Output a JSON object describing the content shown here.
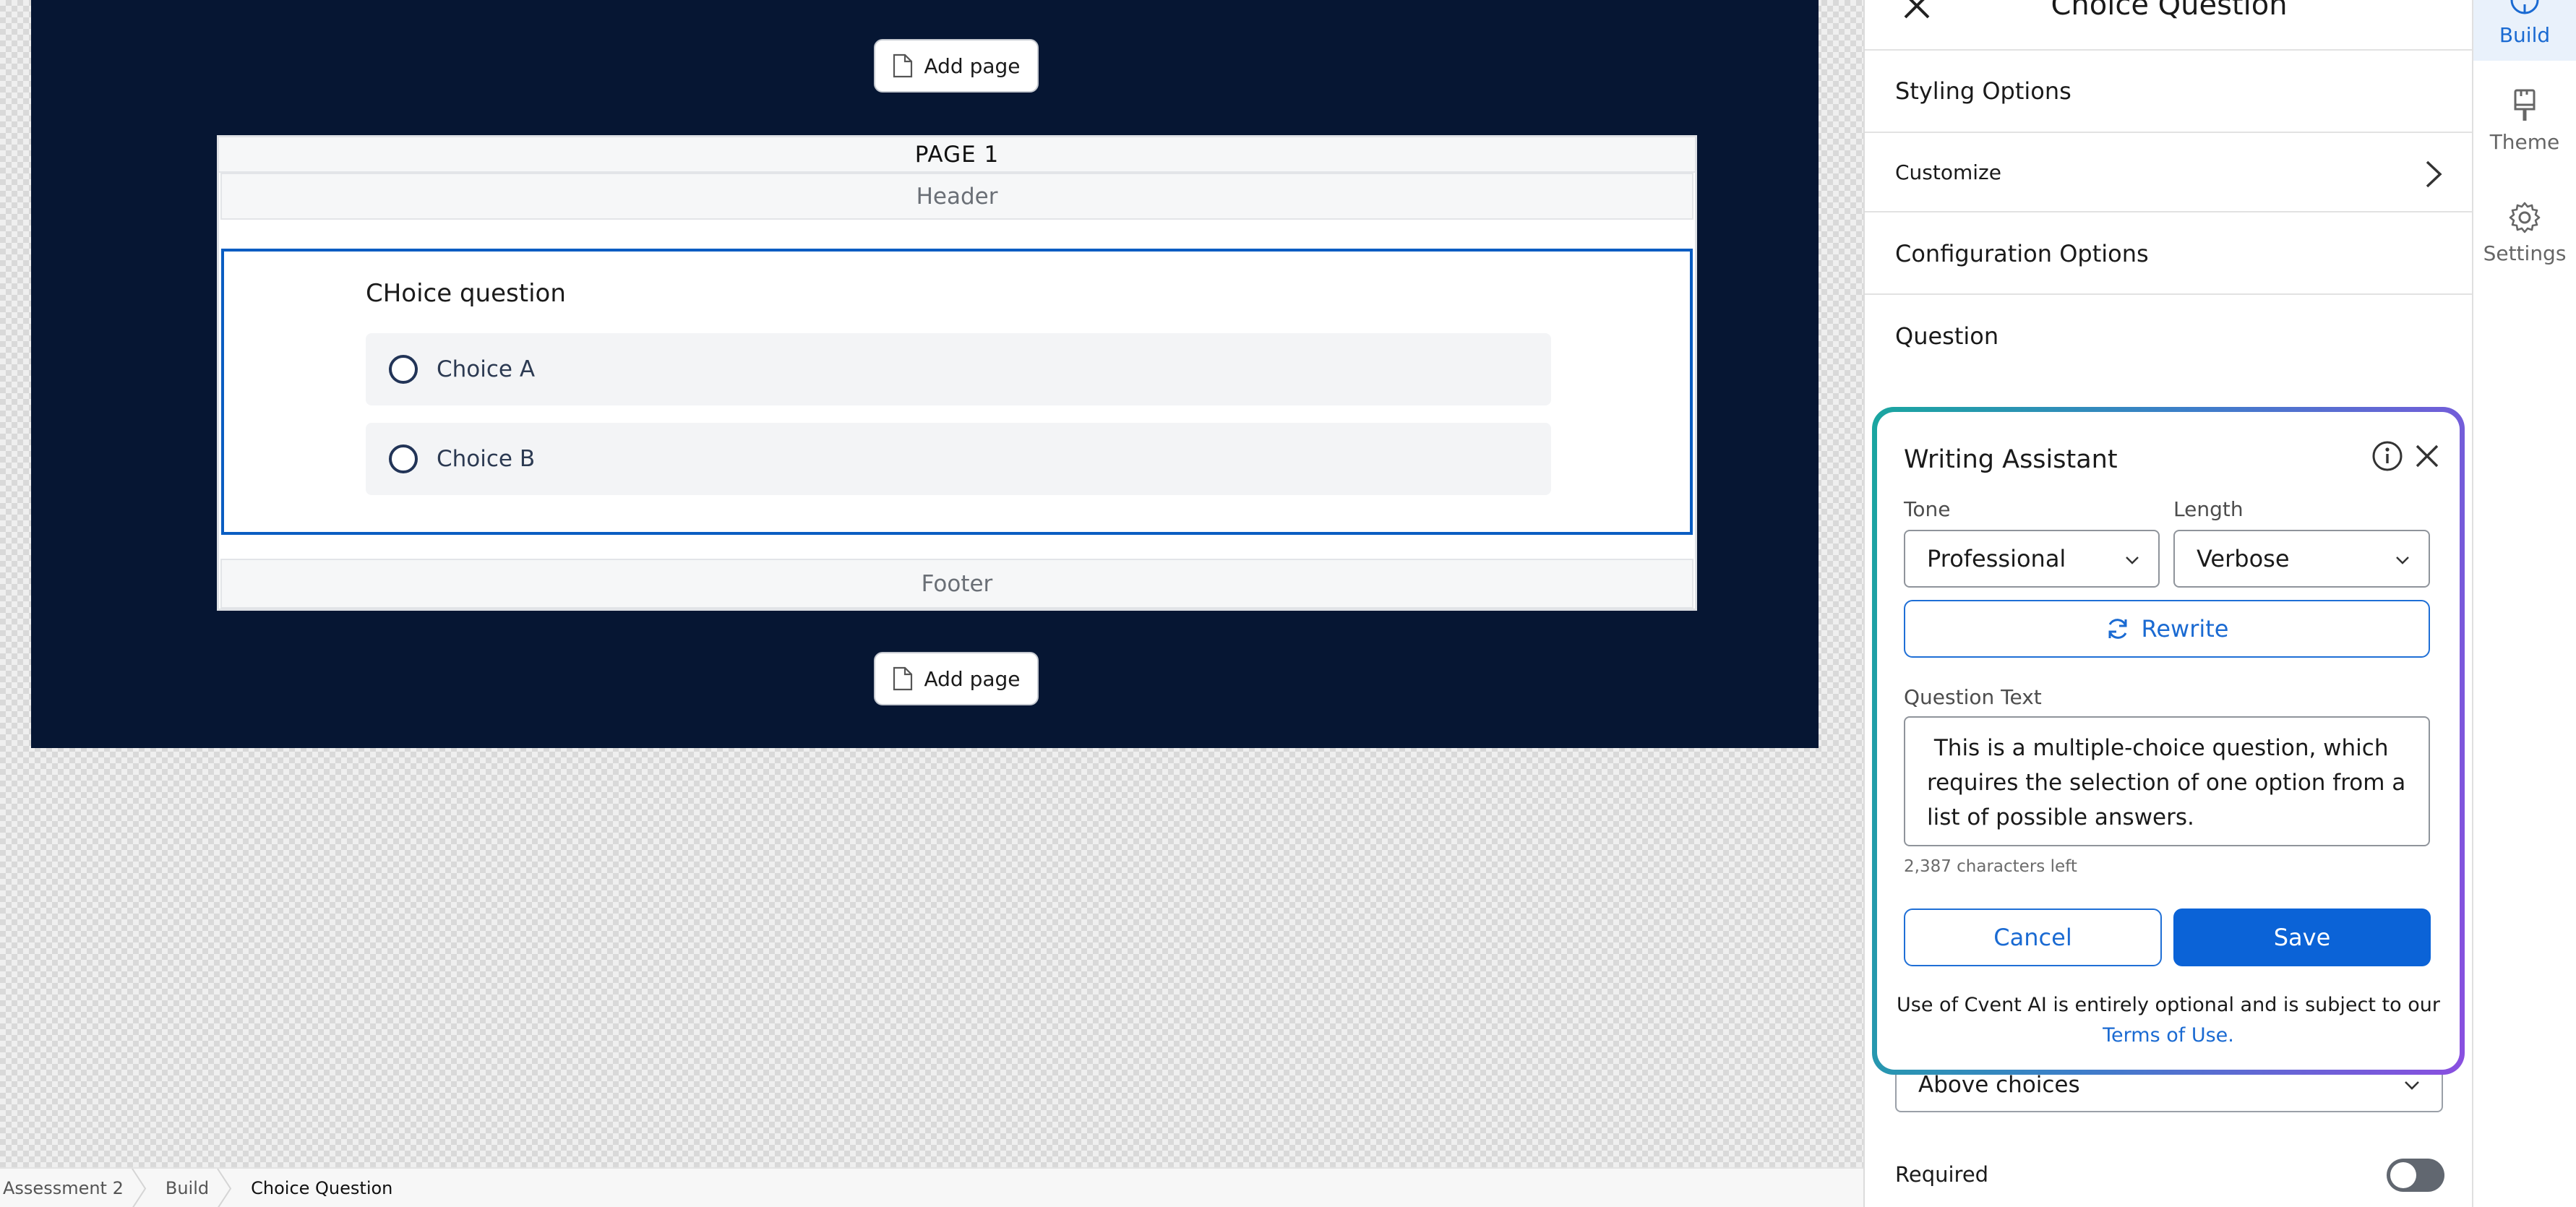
{
  "canvas": {
    "add_page_label": "Add page",
    "page_title": "PAGE 1",
    "header_label": "Header",
    "footer_label": "Footer",
    "question": {
      "title": "CHoice question",
      "choices": [
        "Choice A",
        "Choice B"
      ]
    }
  },
  "breadcrumb": {
    "items": [
      "Assessment 2",
      "Build",
      "Choice Question"
    ]
  },
  "panel": {
    "title": "Choice Question",
    "styling_options": "Styling Options",
    "customize": "Customize",
    "configuration_options": "Configuration Options",
    "question": "Question",
    "question_position": "Above choices",
    "required_label": "Required"
  },
  "writing_assistant": {
    "title": "Writing Assistant",
    "tone_label": "Tone",
    "tone_value": "Professional",
    "length_label": "Length",
    "length_value": "Verbose",
    "rewrite_label": "Rewrite",
    "question_text_label": "Question Text",
    "question_text": " This is a multiple-choice question, which requires the selection of one option from a list of possible answers.",
    "chars_left": "2,387 characters left",
    "cancel_label": "Cancel",
    "save_label": "Save",
    "disclaimer": "Use of Cvent AI is entirely optional and is subject to our",
    "terms_link": "Terms of Use."
  },
  "rail": {
    "build": "Build",
    "theme": "Theme",
    "settings": "Settings"
  },
  "colors": {
    "stage_bg": "#061633",
    "accent_blue": "#0b63d7",
    "selection_border": "#0a5dc2",
    "ai_gradient_start": "#1aa6a0",
    "ai_gradient_end": "#8a4fe0"
  }
}
